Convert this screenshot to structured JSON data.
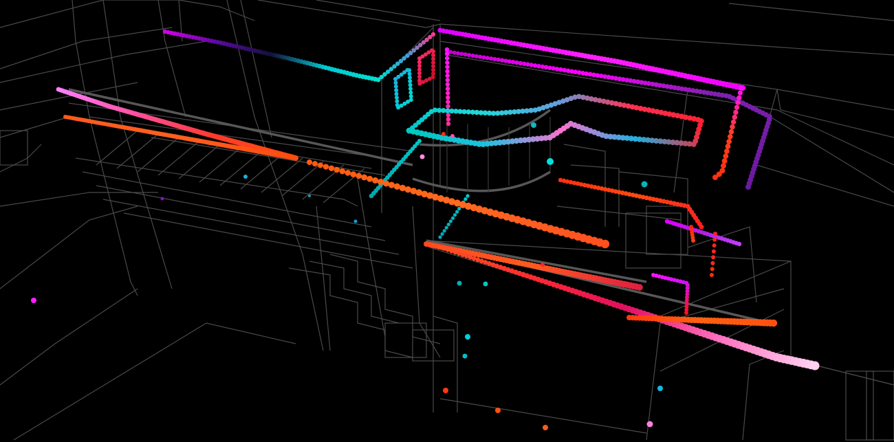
{
  "scene": {
    "background": "#000000",
    "wireframe_color": "#4a4a4a",
    "trail_palette": [
      "#ff00ff",
      "#c800d8",
      "#7a1aa8",
      "#00e0d0",
      "#18c0e0",
      "#ff2a2a",
      "#ff5a1a",
      "#ff7ad8"
    ]
  }
}
